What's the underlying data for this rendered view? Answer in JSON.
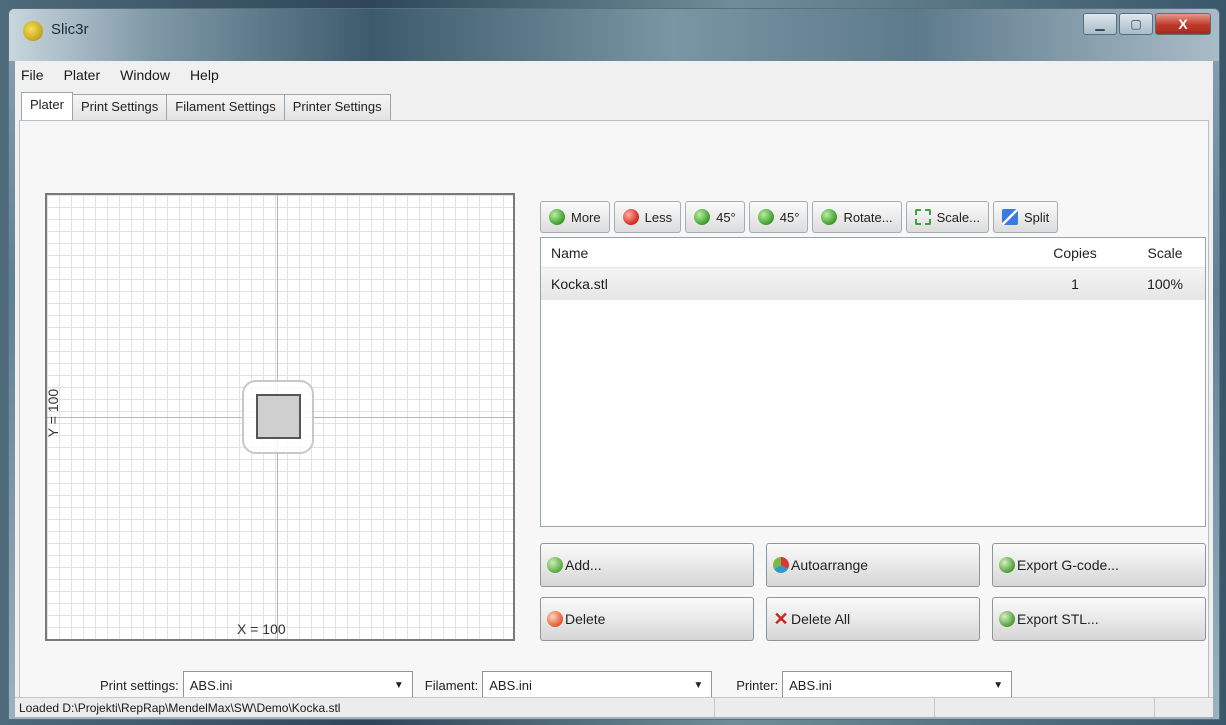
{
  "window": {
    "title": "Slic3r",
    "minimize_glyph": "▁",
    "maximize_glyph": "▢",
    "close_glyph": "X"
  },
  "menu": {
    "items": [
      {
        "label": "File"
      },
      {
        "label": "Plater"
      },
      {
        "label": "Window"
      },
      {
        "label": "Help"
      }
    ]
  },
  "tabs": [
    {
      "label": "Plater",
      "active": true
    },
    {
      "label": "Print Settings",
      "active": false
    },
    {
      "label": "Filament Settings",
      "active": false
    },
    {
      "label": "Printer Settings",
      "active": false
    }
  ],
  "plater": {
    "x_label": "X = 100",
    "y_label": "Y = 100"
  },
  "toolbar": {
    "more": {
      "label": "More",
      "icon": "plus-circle-icon"
    },
    "less": {
      "label": "Less",
      "icon": "minus-circle-icon"
    },
    "rotate_ccw": {
      "label": "45°",
      "icon": "rotate-ccw-icon"
    },
    "rotate_cw": {
      "label": "45°",
      "icon": "rotate-cw-icon"
    },
    "rotate": {
      "label": "Rotate...",
      "icon": "rotate-icon"
    },
    "scale": {
      "label": "Scale...",
      "icon": "scale-icon"
    },
    "split": {
      "label": "Split",
      "icon": "split-icon"
    }
  },
  "object_list": {
    "columns": {
      "name": "Name",
      "copies": "Copies",
      "scale": "Scale"
    },
    "rows": [
      {
        "name": "Kocka.stl",
        "copies": "1",
        "scale": "100%"
      }
    ]
  },
  "actions": {
    "add": "Add...",
    "autoarrange": "Autoarrange",
    "export_gcode": "Export G-code...",
    "delete": "Delete",
    "delete_all": "Delete All",
    "export_stl": "Export STL..."
  },
  "settings": {
    "print_label": "Print settings:",
    "print_value": "ABS.ini",
    "filament_label": "Filament:",
    "filament_value": "ABS.ini",
    "printer_label": "Printer:",
    "printer_value": "ABS.ini"
  },
  "status": {
    "text": "Loaded D:\\Projekti\\RepRap\\MendelMax\\SW\\Demo\\Kocka.stl"
  }
}
